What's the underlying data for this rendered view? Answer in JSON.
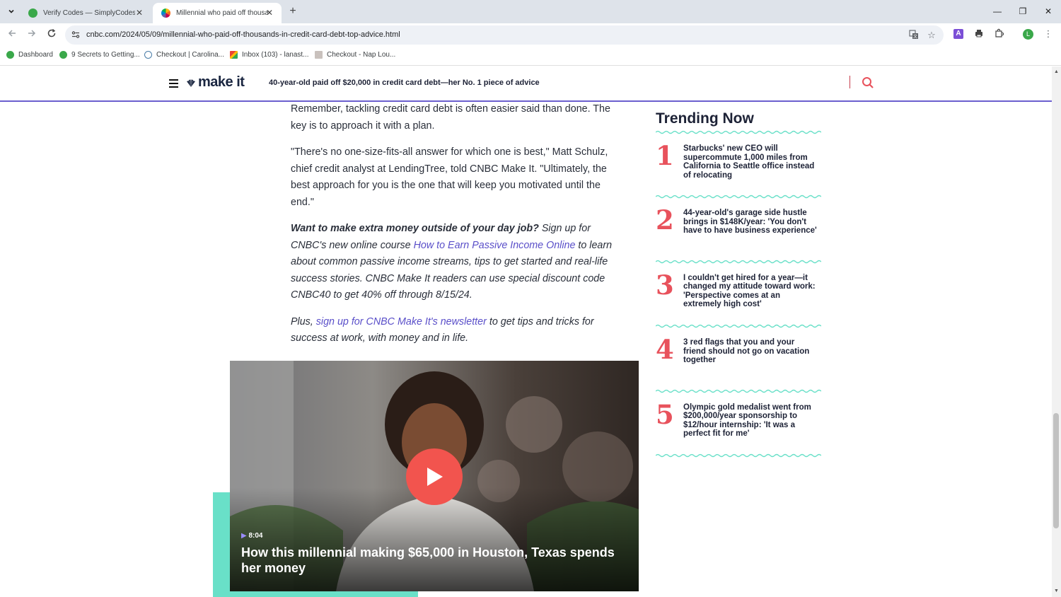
{
  "browser": {
    "tabs": [
      {
        "title": "Verify Codes — SimplyCodes",
        "active": false
      },
      {
        "title": "Millennial who paid off thousa",
        "active": true
      }
    ],
    "url": "cnbc.com/2024/05/09/millennial-who-paid-off-thousands-in-credit-card-debt-top-advice.html",
    "bookmarks": [
      {
        "label": "Dashboard"
      },
      {
        "label": "9 Secrets to Getting..."
      },
      {
        "label": "Checkout | Carolina..."
      },
      {
        "label": "Inbox (103) - lanast..."
      },
      {
        "label": "Checkout - Nap Lou..."
      }
    ],
    "profile_initial": "L",
    "colors": {
      "tabstrip": "#dee3ea",
      "accent_purple": "#6b5fcf",
      "trending_red": "#e8525c",
      "teal": "#69e0c8"
    }
  },
  "site": {
    "logo_sub": "CNBC",
    "logo_text": "make it",
    "header_title": "40-year-old paid off $20,000 in credit card debt—her No. 1 piece of advice"
  },
  "article": {
    "p1": "Remember, tackling credit card debt is often easier said than done. The key is to approach it with a plan.",
    "p2": "\"There's no one-size-fits-all answer for which one is best,\" Matt Schulz, chief credit analyst at LendingTree, told CNBC Make It. \"Ultimately, the best approach for you is the one that will keep you motivated until the end.\"",
    "promo_bold": "Want to make extra money outside of your day job?",
    "promo_text1": " Sign up for CNBC's new online course ",
    "promo_link": "How to Earn Passive Income Online",
    "promo_text2": " to learn about common passive income streams, tips to get started and real-life success stories. CNBC Make It readers can use special discount code CNBC40 to get 40% off through 8/15/24.",
    "plus_text1": "Plus, ",
    "plus_link": "sign up for CNBC Make It's newsletter",
    "plus_text2": " to get tips and tricks for success at work, with money and in life."
  },
  "video": {
    "duration": "8:04",
    "title": "How this millennial making $65,000 in Houston, Texas spends her money"
  },
  "trending": {
    "heading": "Trending Now",
    "items": [
      {
        "num": "1",
        "text": "Starbucks' new CEO will supercommute 1,000 miles from California to Seattle office instead of relocating"
      },
      {
        "num": "2",
        "text": "44-year-old's garage side hustle brings in $148K/year: 'You don't have to have business experience'"
      },
      {
        "num": "3",
        "text": "I couldn't get hired for a year—it changed my attitude toward work: 'Perspective comes at an extremely high cost'"
      },
      {
        "num": "4",
        "text": "3 red flags that you and your friend should not go on vacation together"
      },
      {
        "num": "5",
        "text": "Olympic gold medalist went from $200,000/year sponsorship to $12/hour internship: 'It was a perfect fit for me'"
      }
    ]
  }
}
